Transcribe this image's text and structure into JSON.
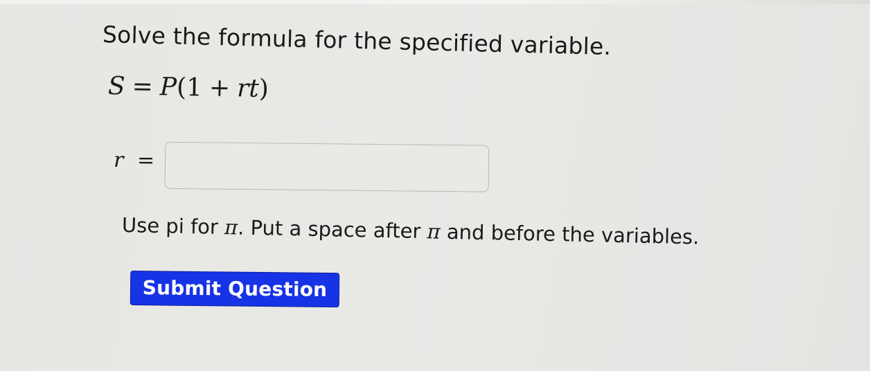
{
  "question": {
    "title": "Solve the formula for the specified variable.",
    "formula": {
      "lhs": "S",
      "equals": "=",
      "rhs_var": "P",
      "open_paren": "(",
      "one": "1",
      "plus": "+",
      "term": "rt",
      "close_paren": ")"
    },
    "answer": {
      "variable": "r",
      "equals": "=",
      "value": ""
    },
    "hint": {
      "before_pi": "Use pi for ",
      "pi_symbol": "π",
      "middle": ". Put a space after ",
      "pi_symbol_2": "π",
      "after": " and before the variables."
    },
    "submit_label": "Submit Question"
  },
  "colors": {
    "background": "#e8e8e5",
    "submit_button": "#1733e6",
    "submit_text": "#ffffff"
  }
}
